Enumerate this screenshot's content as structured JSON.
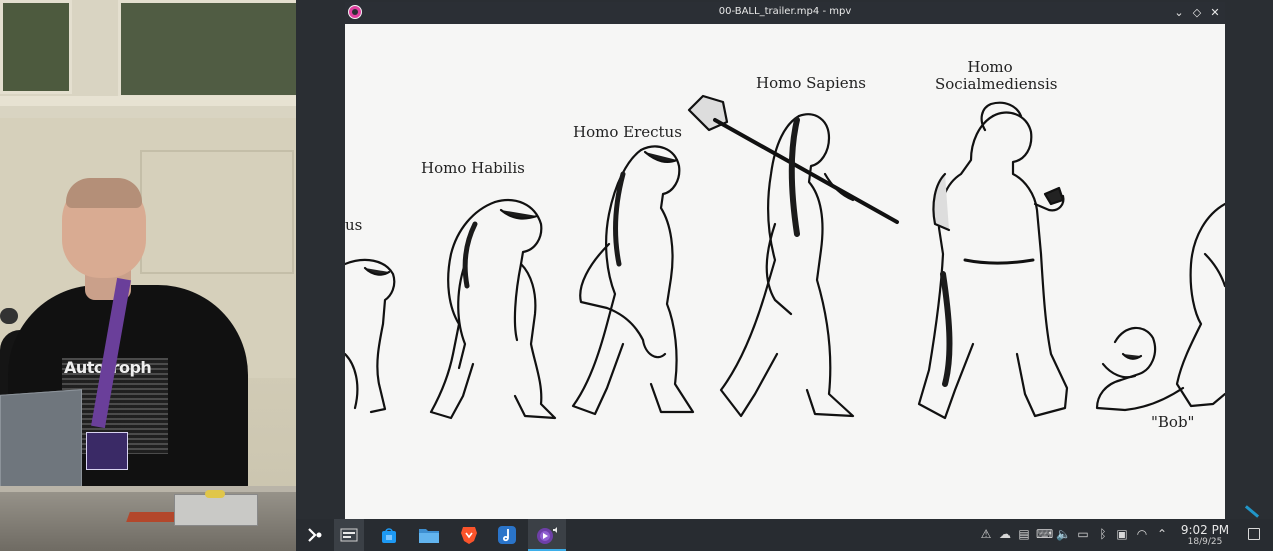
{
  "window": {
    "title": "00-BALL_trailer.mp4 - mpv",
    "controls": {
      "minimize": "⌄",
      "maximize": "◇",
      "close": "✕"
    }
  },
  "video": {
    "labels": {
      "first_partial": "us",
      "habilis": "Homo Habilis",
      "erectus": "Homo Erectus",
      "sapiens": "Homo Sapiens",
      "socialmediensis": "Homo\nSocialmediensis",
      "bob": "\"Bob\""
    }
  },
  "camera": {
    "shirt_text": "Autotroph"
  },
  "taskbar": {
    "launchers": [
      {
        "name": "application-launcher",
        "icon": "kde-launcher-icon"
      },
      {
        "name": "overview",
        "icon": "overview-icon"
      },
      {
        "name": "discover",
        "icon": "store-bag-icon"
      },
      {
        "name": "files",
        "icon": "folder-icon"
      },
      {
        "name": "brave",
        "icon": "brave-lion-icon"
      },
      {
        "name": "music",
        "icon": "note-icon"
      },
      {
        "name": "mpv",
        "icon": "mpv-icon"
      }
    ],
    "clock": {
      "time": "9:02 PM",
      "date": "18/9/25"
    },
    "colors": {
      "background": "#282c31",
      "accent": "#3daee9"
    }
  }
}
